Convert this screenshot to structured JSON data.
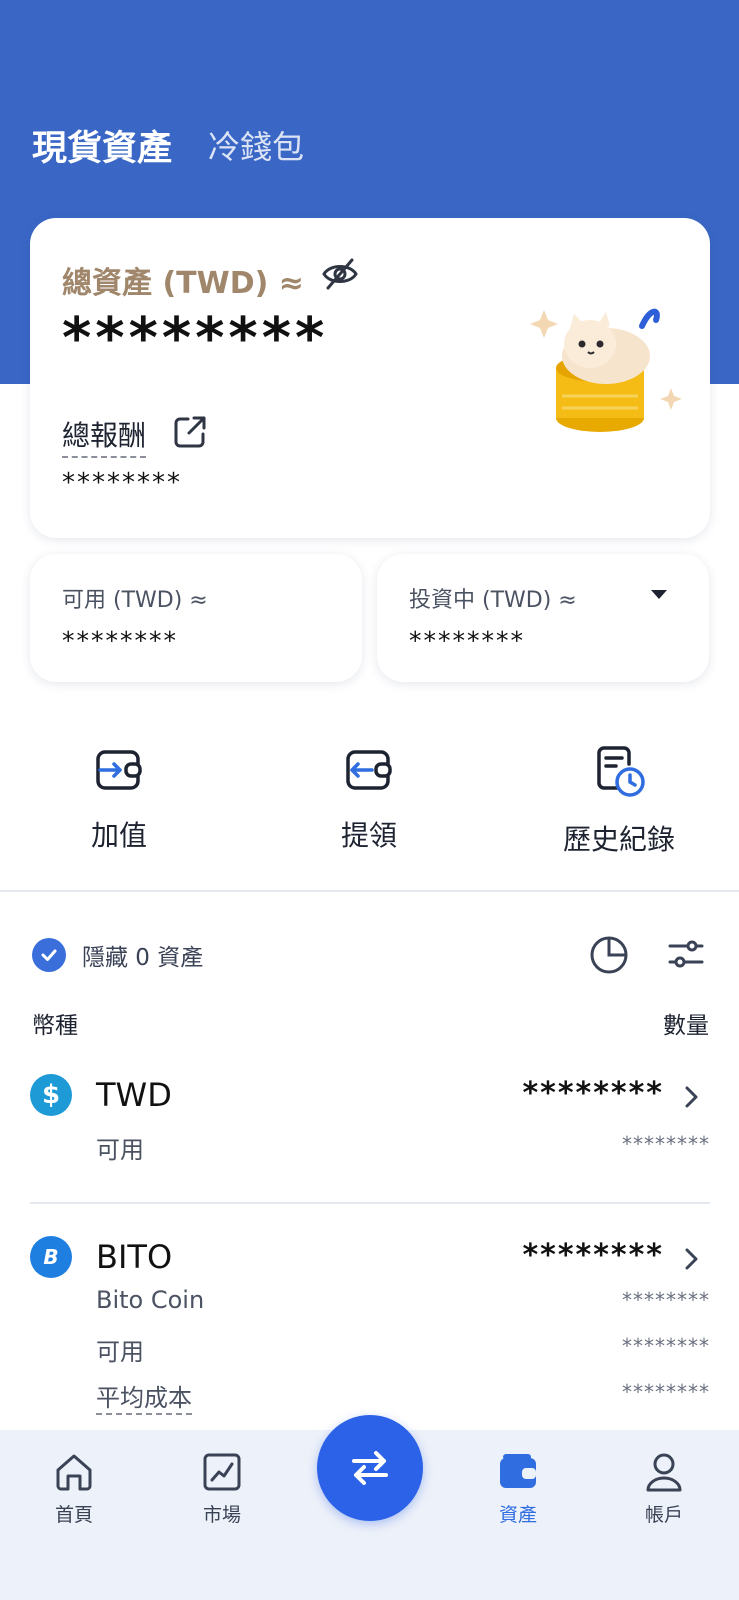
{
  "header": {
    "title": "現貨資產",
    "subtitle": "冷錢包"
  },
  "total_card": {
    "label": "總資產 (TWD) ≈",
    "value": "********",
    "reward_label": "總報酬",
    "reward_value": "********",
    "icons": [
      "eye-off-icon",
      "external-link-icon",
      "cat-coin-illustration"
    ]
  },
  "available": {
    "label": "可用 (TWD) ≈",
    "value": "********"
  },
  "investing": {
    "label": "投資中 (TWD) ≈",
    "value": "********"
  },
  "actions": [
    {
      "label": "加值",
      "icon": "wallet-deposit-icon"
    },
    {
      "label": "提領",
      "icon": "wallet-withdraw-icon"
    },
    {
      "label": "歷史紀錄",
      "icon": "history-icon"
    }
  ],
  "asset_list": {
    "hide_label": "隱藏 0 資產",
    "col_coin": "幣種",
    "col_qty": "數量",
    "coins": [
      {
        "symbol": "TWD",
        "total": "********",
        "rows": [
          {
            "label": "可用",
            "value": "********"
          }
        ]
      },
      {
        "symbol": "BITO",
        "total": "********",
        "rows": [
          {
            "label": "Bito Coin",
            "value": "********"
          },
          {
            "label": "可用",
            "value": "********"
          },
          {
            "label": "平均成本",
            "value": "********"
          }
        ]
      }
    ]
  },
  "nav": [
    {
      "label": "首頁",
      "icon": "home-icon"
    },
    {
      "label": "市場",
      "icon": "market-chart-icon"
    },
    {
      "label": "資產",
      "icon": "wallet-icon",
      "active": true
    },
    {
      "label": "帳戶",
      "icon": "user-icon"
    }
  ],
  "colors": {
    "brand_blue": "#3a67c6",
    "accent": "#2c62e8",
    "gold_label": "#a0866a"
  }
}
